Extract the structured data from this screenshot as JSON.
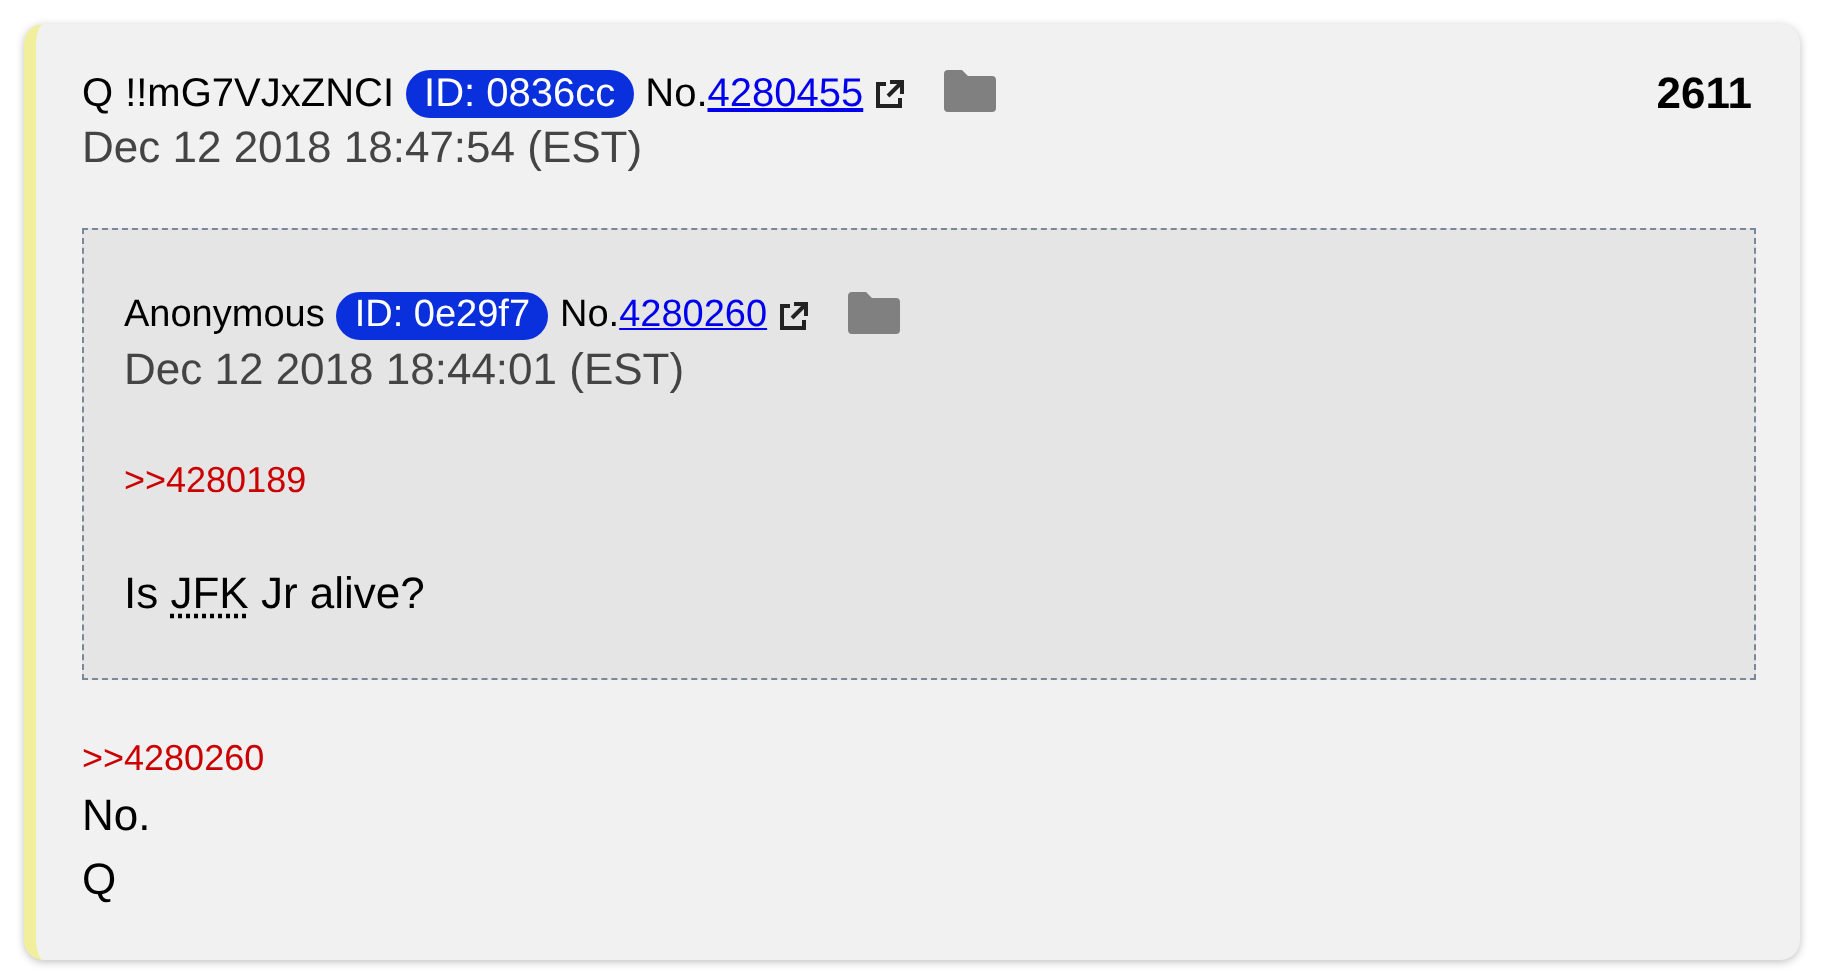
{
  "post": {
    "count": "2611",
    "header": {
      "name": "Q",
      "tripcode": "!!mG7VJxZNCI",
      "id_badge": "ID: 0836cc",
      "no_label": "No.",
      "post_number": "4280455",
      "date": "Dec 12 2018 18:47:54 (EST)"
    },
    "quote": {
      "header": {
        "name": "Anonymous",
        "id_badge": "ID: 0e29f7",
        "no_label": "No.",
        "post_number": "4280260",
        "date": "Dec 12 2018 18:44:01 (EST)"
      },
      "body": [
        {
          "kind": "reply_link",
          "text": ">>4280189"
        },
        {
          "kind": "text",
          "parts": [
            {
              "text": "Is "
            },
            {
              "text": "JFK",
              "abbr": true
            },
            {
              "text": " Jr alive?"
            }
          ]
        }
      ]
    },
    "body": [
      {
        "kind": "reply_link",
        "text": ">>4280260"
      },
      {
        "kind": "text",
        "parts": [
          {
            "text": "No."
          }
        ]
      },
      {
        "kind": "text",
        "parts": [
          {
            "text": "Q"
          }
        ]
      }
    ]
  }
}
